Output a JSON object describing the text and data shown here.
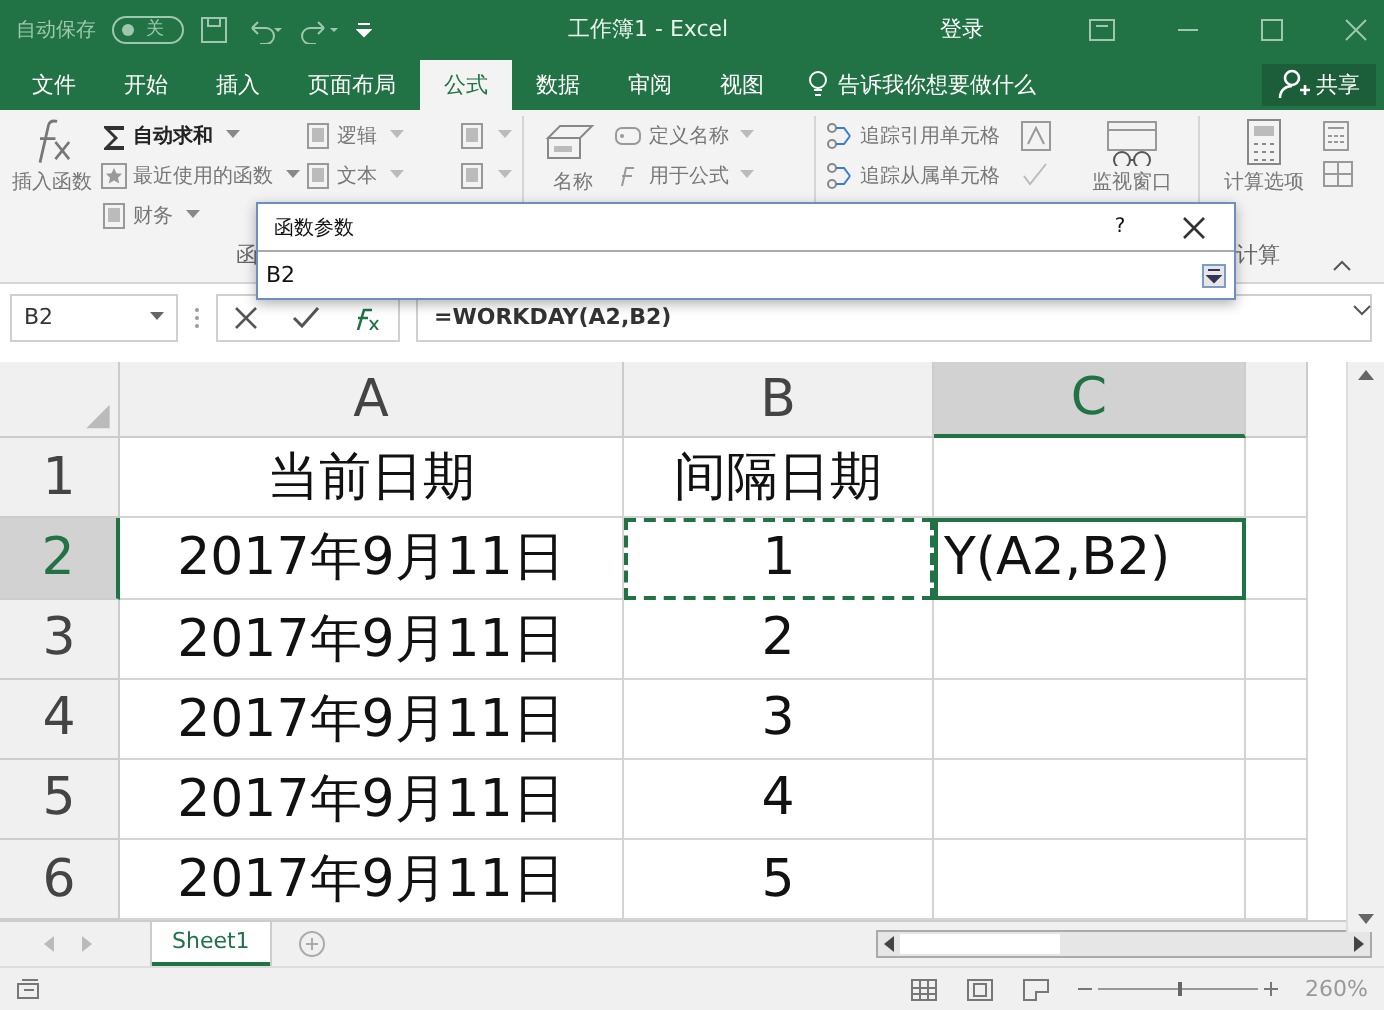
{
  "title_bar": {
    "autosave_label": "自动保存",
    "autosave": {
      "on": false,
      "label": "关"
    },
    "title": "工作簿1  -  Excel",
    "sign_in": "登录"
  },
  "tabs": [
    {
      "label": "文件",
      "selected": false
    },
    {
      "label": "开始",
      "selected": false
    },
    {
      "label": "插入",
      "selected": false
    },
    {
      "label": "页面布局",
      "selected": false
    },
    {
      "label": "公式",
      "selected": true
    },
    {
      "label": "数据",
      "selected": false
    },
    {
      "label": "审阅",
      "selected": false
    },
    {
      "label": "视图",
      "selected": false
    }
  ],
  "tell_me": "告诉我你想要做什么",
  "share": "共享",
  "ribbon": {
    "insert_function": "插入函数",
    "library_column_1": [
      {
        "label": "自动求和"
      },
      {
        "label": "最近使用的函数"
      },
      {
        "label": "财务"
      }
    ],
    "library_column_2": [
      {
        "label": "逻辑"
      },
      {
        "label": "文本"
      }
    ],
    "name_manager": "名称",
    "names": [
      {
        "label": "定义名称"
      },
      {
        "label": "用于公式"
      }
    ],
    "auditing": [
      {
        "label": "追踪引用单元格"
      },
      {
        "label": "追踪从属单元格"
      }
    ],
    "watch_window": "监视窗口",
    "calc_options": "计算选项",
    "group_labels": [
      {
        "label": "函"
      },
      {
        "label": "计算"
      }
    ]
  },
  "dialog": {
    "title": "函数参数",
    "help": "?",
    "value": "B2"
  },
  "formula_bar": {
    "name_box": "B2",
    "formula": "=WORKDAY(A2,B2)"
  },
  "columns": [
    {
      "label": "A",
      "selected": false
    },
    {
      "label": "B",
      "selected": false
    },
    {
      "label": "C",
      "selected": true
    }
  ],
  "rows": [
    {
      "number": "1",
      "selected": false,
      "cells": [
        {
          "text": "当前日期"
        },
        {
          "text": "间隔日期"
        },
        {
          "text": ""
        }
      ]
    },
    {
      "number": "2",
      "selected": true,
      "cells": [
        {
          "text": "2017年9月11日"
        },
        {
          "text": "1",
          "referenced": true
        },
        {
          "text": "Y(A2,B2)",
          "active": true
        }
      ]
    },
    {
      "number": "3",
      "selected": false,
      "cells": [
        {
          "text": "2017年9月11日"
        },
        {
          "text": "2"
        },
        {
          "text": ""
        }
      ]
    },
    {
      "number": "4",
      "selected": false,
      "cells": [
        {
          "text": "2017年9月11日"
        },
        {
          "text": "3"
        },
        {
          "text": ""
        }
      ]
    },
    {
      "number": "5",
      "selected": false,
      "cells": [
        {
          "text": "2017年9月11日"
        },
        {
          "text": "4"
        },
        {
          "text": ""
        }
      ]
    },
    {
      "number": "6",
      "selected": false,
      "cells": [
        {
          "text": "2017年9月11日"
        },
        {
          "text": "5"
        },
        {
          "text": ""
        }
      ]
    }
  ],
  "sheet_tabs": [
    {
      "label": "Sheet1",
      "selected": true
    }
  ],
  "status_bar": {
    "zoom_slider": {
      "level": 0.5
    },
    "zoom": "260%"
  }
}
